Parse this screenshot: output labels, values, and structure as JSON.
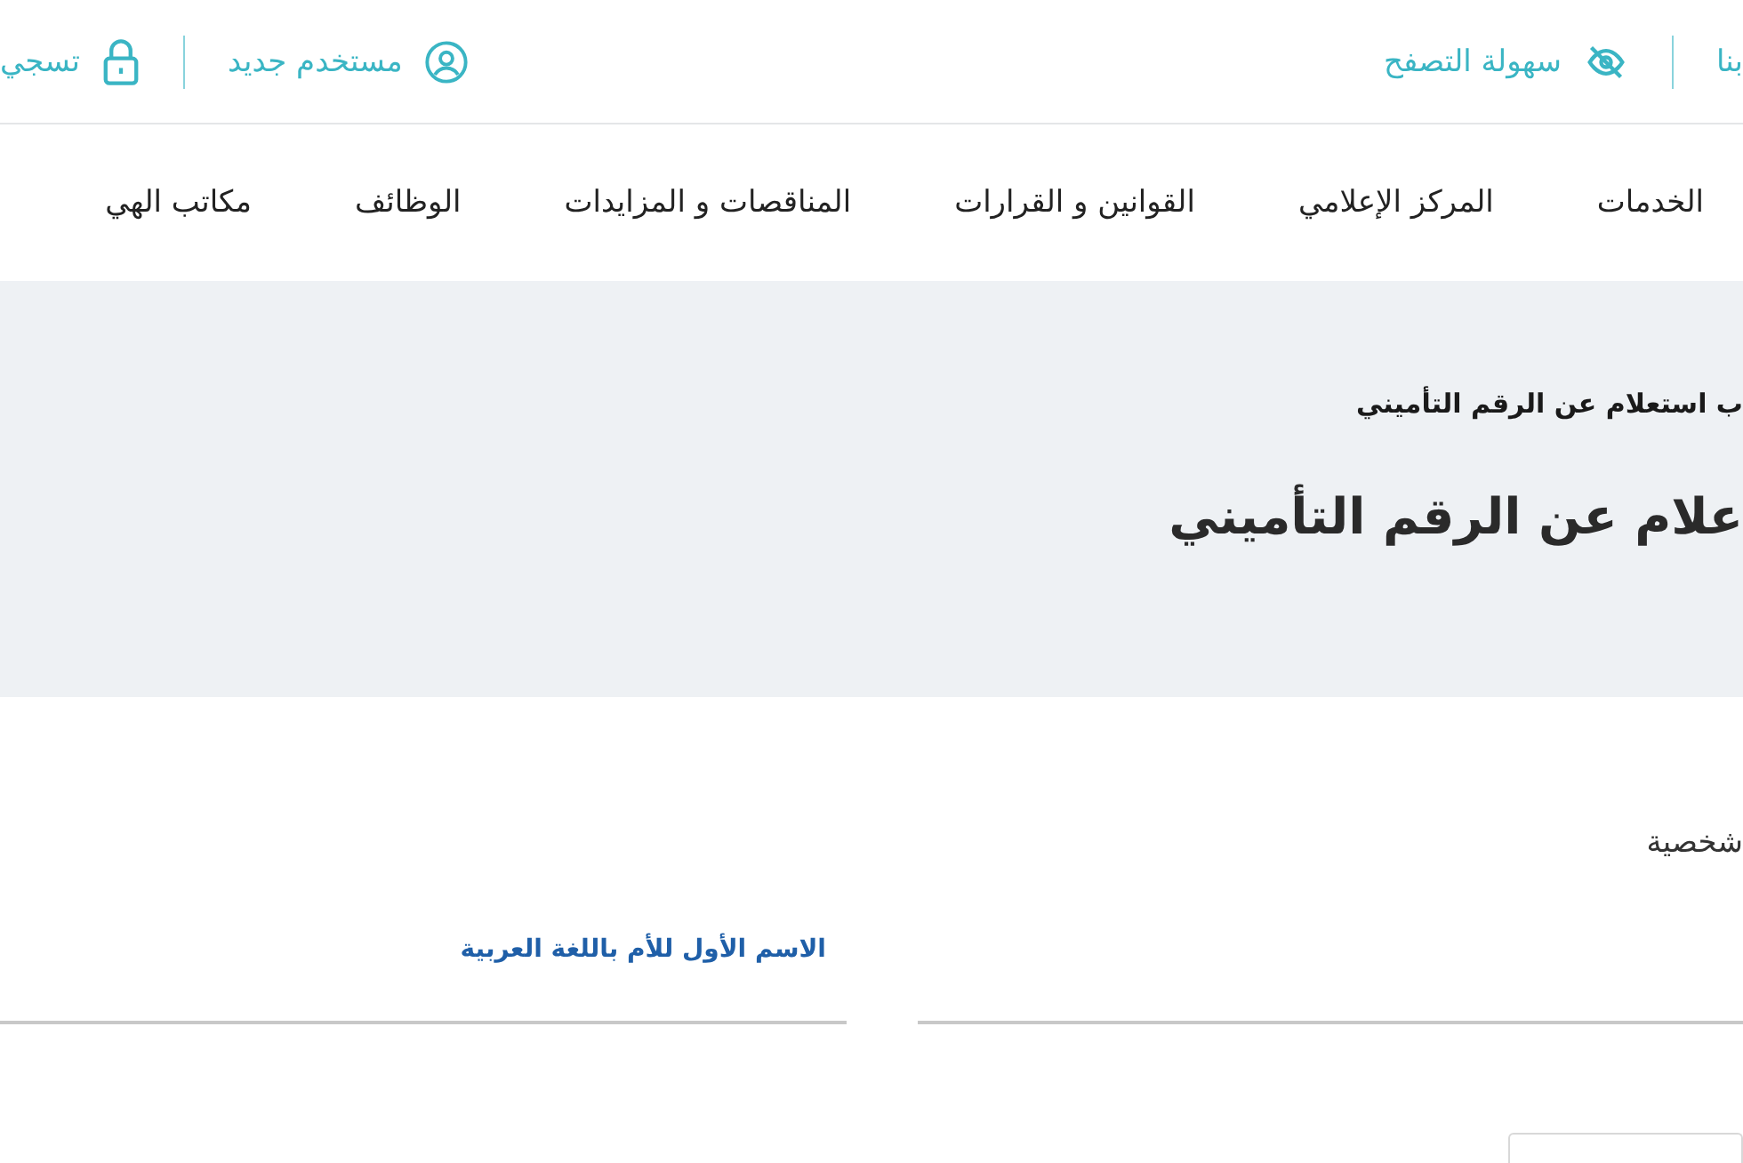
{
  "top_bar": {
    "right_links": [
      {
        "label": "بنا"
      },
      {
        "label": "سهولة التصفح"
      }
    ],
    "left_links": [
      {
        "label": "مستخدم جديد"
      },
      {
        "label": "تسجي"
      }
    ]
  },
  "nav": {
    "items": [
      "الخدمات",
      "المركز الإعلامي",
      "القوانين و القرارات",
      "المناقصات و المزايدات",
      "الوظائف",
      "مكاتب الهي"
    ]
  },
  "hero": {
    "breadcrumb": "ب استعلام عن الرقم التأميني",
    "title": "علام عن الرقم التأميني"
  },
  "form": {
    "section_title": "شخصية",
    "fields": [
      {
        "kind": "plain"
      },
      {
        "kind": "labeled",
        "label": "الاسم الأول للأم باللغة العربية"
      }
    ]
  }
}
